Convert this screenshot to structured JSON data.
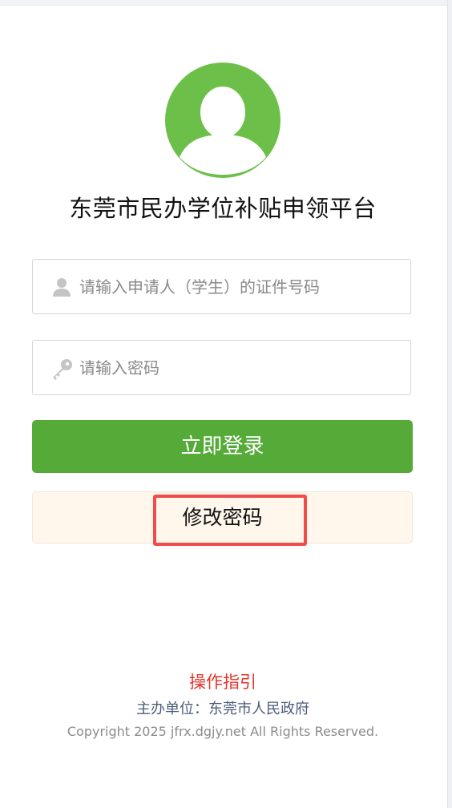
{
  "app": {
    "title": "东莞市民办学位补贴申领平台"
  },
  "form": {
    "id_input": {
      "placeholder": "请输入申请人（学生）的证件号码",
      "value": "",
      "icon": "user-icon"
    },
    "password_input": {
      "placeholder": "请输入密码",
      "value": "",
      "icon": "key-icon"
    },
    "login_label": "立即登录",
    "change_password_label": "修改密码"
  },
  "footer": {
    "guide_label": "操作指引",
    "sponsor": "主办单位：东莞市人民政府",
    "copyright": "Copyright 2025 jfrx.dgjy.net All Rights Reserved."
  },
  "colors": {
    "avatar": "#6cc04a",
    "primary_button": "#55aa38",
    "secondary_button_bg": "#fff6ec",
    "guide_link": "#e2342b",
    "highlight": "#ef4c4c"
  }
}
